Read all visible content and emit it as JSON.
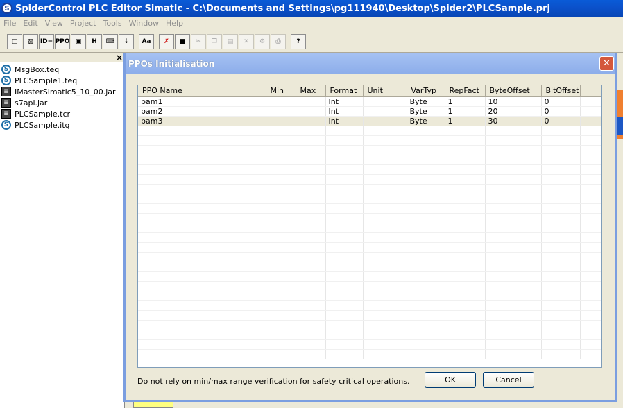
{
  "window": {
    "title": "SpiderControl PLC Editor Simatic - C:\\Documents and Settings\\pg111940\\Desktop\\Spider2\\PLCSample.prj",
    "icon": "spidercontrol-app-icon"
  },
  "menu": [
    "File",
    "Edit",
    "View",
    "Project",
    "Tools",
    "Window",
    "Help"
  ],
  "toolbar": {
    "buttons": [
      {
        "name": "new-file-icon",
        "glyph": "□"
      },
      {
        "name": "open-folder-icon",
        "glyph": "▨"
      },
      {
        "name": "id-icon",
        "glyph": "ID="
      },
      {
        "name": "ppo-icon",
        "glyph": "PPO"
      },
      {
        "name": "stack-icon",
        "glyph": "▣"
      },
      {
        "name": "html-icon",
        "glyph": "H"
      },
      {
        "name": "keyboard-icon",
        "glyph": "⌨"
      },
      {
        "name": "transfer-icon",
        "glyph": "⇣"
      },
      {
        "name": "font-icon",
        "glyph": "Aa"
      },
      {
        "name": "delete-red-icon",
        "glyph": "✗"
      },
      {
        "name": "save-icon",
        "glyph": "■"
      },
      {
        "name": "cut-icon",
        "glyph": "✂"
      },
      {
        "name": "copy-icon",
        "glyph": "❐"
      },
      {
        "name": "paste-icon",
        "glyph": "▤"
      },
      {
        "name": "delete-icon",
        "glyph": "✕"
      },
      {
        "name": "properties-icon",
        "glyph": "⚙"
      },
      {
        "name": "print-icon",
        "glyph": "⎙"
      },
      {
        "name": "help-icon",
        "glyph": "?"
      }
    ]
  },
  "files": [
    {
      "name": "MsgBox.teq",
      "type": "spider"
    },
    {
      "name": "PLCSample1.teq",
      "type": "spider"
    },
    {
      "name": "IMasterSimatic5_10_00.jar",
      "type": "jar"
    },
    {
      "name": "s7api.jar",
      "type": "jar"
    },
    {
      "name": "PLCSample.tcr",
      "type": "jar"
    },
    {
      "name": "PLCSample.itq",
      "type": "spider"
    }
  ],
  "dialog": {
    "title": "PPOs Initialisation",
    "columns": [
      "PPO Name",
      "Min",
      "Max",
      "Format",
      "Unit",
      "VarTyp",
      "RepFact",
      "ByteOffset",
      "BitOffset"
    ],
    "rows": [
      [
        "pam1",
        "",
        "",
        "Int",
        "",
        "Byte",
        "1",
        "10",
        "0"
      ],
      [
        "pam2",
        "",
        "",
        "Int",
        "",
        "Byte",
        "1",
        "20",
        "0"
      ],
      [
        "pam3",
        "",
        "",
        "Int",
        "",
        "Byte",
        "1",
        "30",
        "0"
      ]
    ],
    "selected_row": 2,
    "note": "Do not rely on min/max range verification for safety critical operations.",
    "ok_label": "OK",
    "cancel_label": "Cancel"
  }
}
